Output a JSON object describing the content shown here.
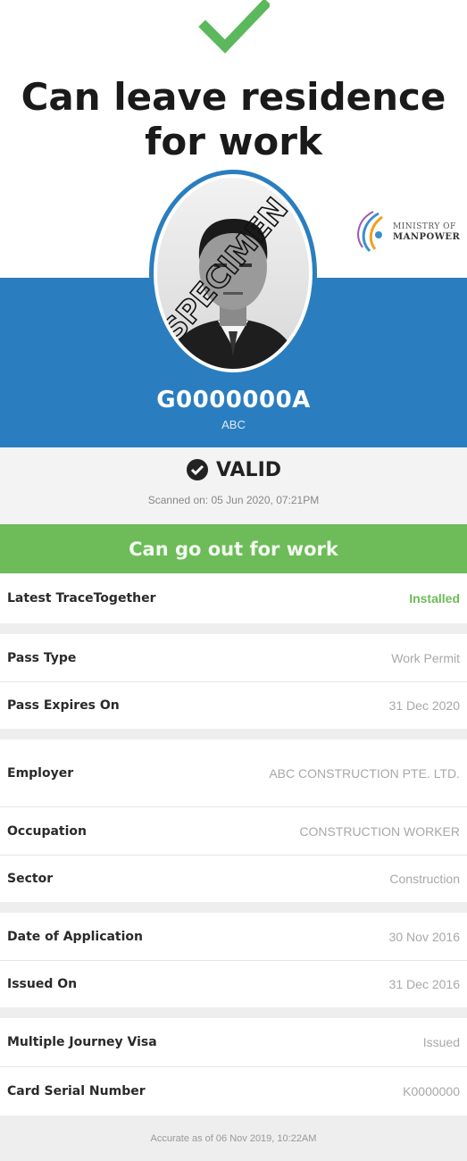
{
  "status": {
    "icon": "checkmark-icon",
    "headline_line1": "Can leave residence",
    "headline_line2": "for work",
    "accent_color": "#5cb85c"
  },
  "card": {
    "photo_watermark": "SPECIMEN",
    "logo": {
      "icon": "ministry-of-manpower-logo",
      "line1": "MINISTRY OF",
      "line2": "MANPOWER"
    },
    "id_number": "G0000000A",
    "name": "ABC",
    "band_color": "#2a7ec0"
  },
  "validity": {
    "icon": "check-circle-icon",
    "label": "VALID",
    "scanned_on": "Scanned on: 05 Jun 2020, 07:21PM"
  },
  "work_status": {
    "label": "Can go out for work",
    "color": "#6dbb59"
  },
  "details": {
    "trace_together": {
      "label": "Latest TraceTogether",
      "value": "Installed"
    },
    "pass_type": {
      "label": "Pass Type",
      "value": "Work Permit"
    },
    "pass_expires": {
      "label": "Pass Expires On",
      "value": "31 Dec 2020"
    },
    "employer": {
      "label": "Employer",
      "value": "ABC CONSTRUCTION PTE. LTD."
    },
    "occupation": {
      "label": "Occupation",
      "value": "CONSTRUCTION WORKER"
    },
    "sector": {
      "label": "Sector",
      "value": "Construction"
    },
    "date_of_application": {
      "label": "Date of Application",
      "value": "30 Nov 2016"
    },
    "issued_on": {
      "label": "Issued On",
      "value": "31 Dec 2016"
    },
    "multiple_journey_visa": {
      "label": "Multiple Journey Visa",
      "value": "Issued"
    },
    "card_serial": {
      "label": "Card Serial Number",
      "value": "K0000000"
    }
  },
  "footer": {
    "accurate_as_of": "Accurate as of 06 Nov 2019, 10:22AM"
  }
}
